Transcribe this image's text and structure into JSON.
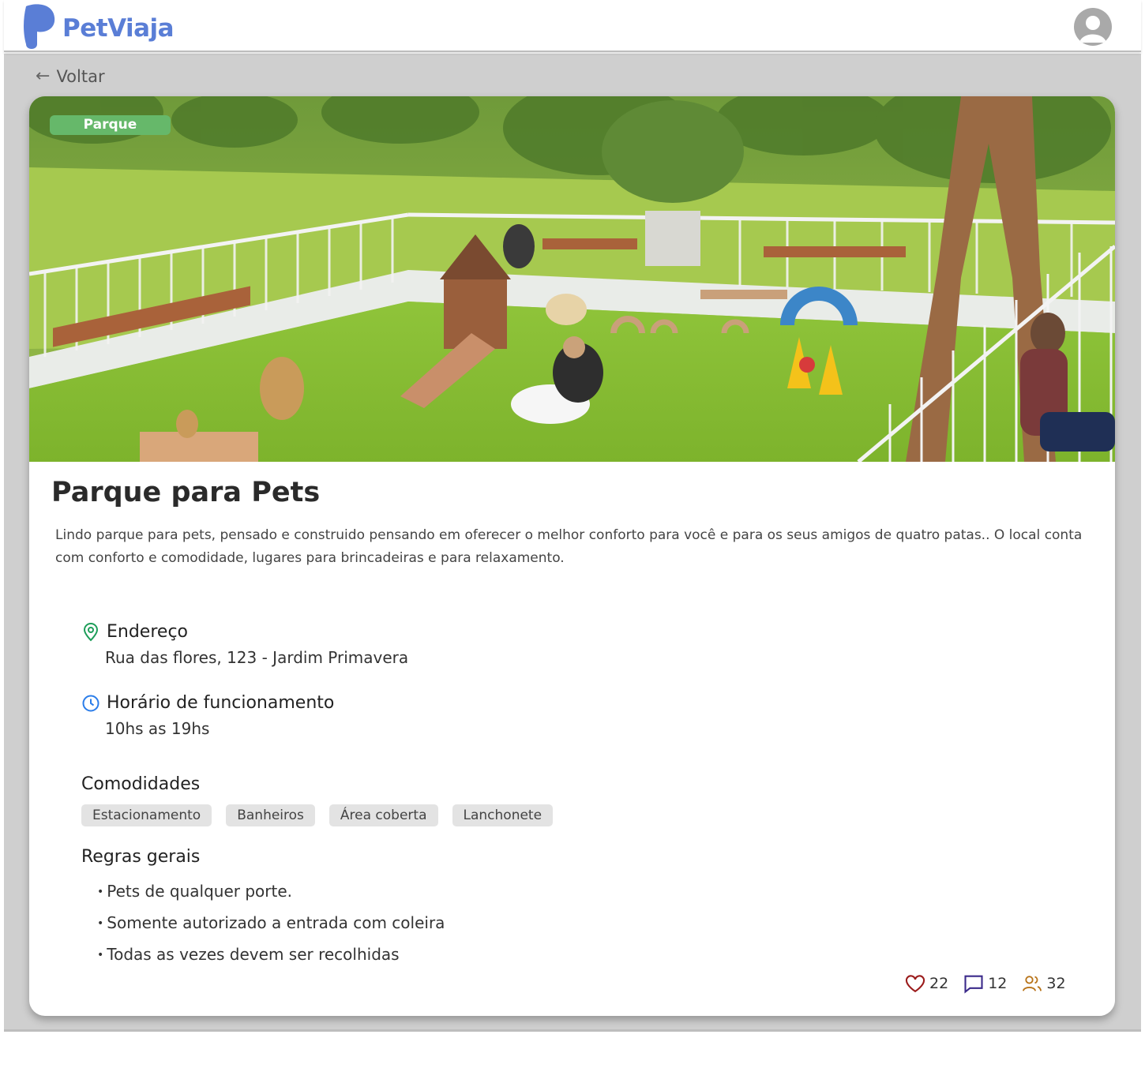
{
  "app": {
    "name": "PetViaja",
    "brand_color": "#5a7ed6"
  },
  "header": {
    "avatar_icon": "user-avatar-icon"
  },
  "nav": {
    "back_label": "Voltar",
    "back_icon": "arrow-left-icon"
  },
  "place": {
    "category_badge": "Parque",
    "badge_color": "#66b86a",
    "title": "Parque para Pets",
    "description": "Lindo parque para pets, pensado e construido pensando em oferecer o melhor conforto para você e para os seus amigos de quatro patas.. O local conta com conforto e comodidade, lugares para brincadeiras e para relaxamento.",
    "address": {
      "label": "Endereço",
      "value": "Rua das flores, 123 - Jardim Primavera",
      "icon": "map-pin-icon",
      "icon_color": "#1e9e5a"
    },
    "hours": {
      "label": "Horário de funcionamento",
      "value": "10hs as 19hs",
      "icon": "clock-icon",
      "icon_color": "#2b7de9"
    },
    "amenities": {
      "label": "Comodidades",
      "items": [
        "Estacionamento",
        "Banheiros",
        "Área coberta",
        "Lanchonete"
      ]
    },
    "rules": {
      "label": "Regras gerais",
      "items": [
        "Pets de qualquer porte.",
        "Somente autorizado a entrada com coleira",
        "Todas as vezes devem ser recolhidas"
      ]
    },
    "stats": {
      "likes": "22",
      "likes_icon": "heart-icon",
      "likes_color": "#9b1c1c",
      "comments": "12",
      "comments_icon": "comment-icon",
      "comments_color": "#3b2a8a",
      "visitors": "32",
      "visitors_icon": "users-icon",
      "visitors_color": "#b8741a"
    }
  }
}
